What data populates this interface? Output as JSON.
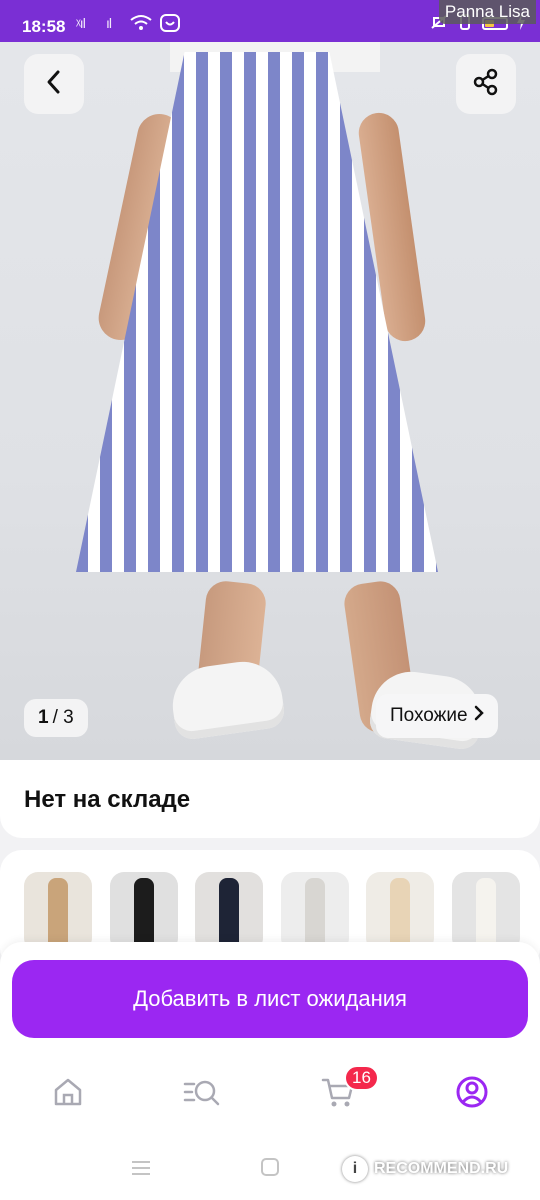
{
  "status_bar": {
    "time": "18:58",
    "signal1": "ᵡıl",
    "signal2": "ıl",
    "wifi": "wifi-icon",
    "app_icon": "messenger-icon",
    "username_overlay": "Panna Lisa"
  },
  "product": {
    "image_counter_current": "1",
    "image_counter_total": "/ 3",
    "similar_label": "Похожие",
    "stock_status": "Нет на складе"
  },
  "thumbnails": [
    {
      "name": "beige-skirt",
      "color": "#c9a47a",
      "bg": "#e9e4dc"
    },
    {
      "name": "black-slit-skirt",
      "color": "#1c1c1c",
      "bg": "#e0e0e0"
    },
    {
      "name": "dark-floral-skirt",
      "color": "#1e2436",
      "bg": "#e2e0de"
    },
    {
      "name": "grey-slit-skirt",
      "color": "#d8d6d2",
      "bg": "#ededed"
    },
    {
      "name": "floral-midi-skirt",
      "color": "#e8d4b6",
      "bg": "#efece6"
    },
    {
      "name": "white-maxi-skirt",
      "color": "#f5f3ee",
      "bg": "#e4e4e4"
    }
  ],
  "cta": {
    "label": "Добавить в лист ожидания"
  },
  "tabbar": {
    "cart_badge": "16",
    "accent": "#9b27f2"
  },
  "watermark": {
    "text": "RECOMMEND.RU",
    "logo": "i"
  }
}
